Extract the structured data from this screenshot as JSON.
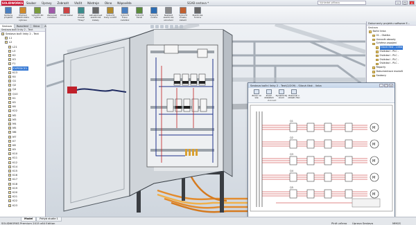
{
  "titlebar": {
    "logo": "SOLIDWORKS",
    "menu": [
      "Soubor",
      "Úpravy",
      "Zobrazit",
      "Vložit",
      "Nástroje",
      "Okno",
      "Nápověda"
    ],
    "document_title": "SGAB sestava *",
    "search_placeholder": "Vyhledat příkazy"
  },
  "ribbon": {
    "buttons": [
      {
        "label": "Správce projektů",
        "color": "#4a7fc0"
      },
      {
        "label": "Přehled elektrického výkresu",
        "color": "#d08a2b"
      },
      {
        "label": "Vytvořit 2D výkres",
        "color": "#7a9c3c"
      },
      {
        "label": "Zarovnat rozložení",
        "color": "#a05aa8"
      },
      {
        "label": "Přidat kabel",
        "color": "#c44"
      },
      {
        "label": "Přidat svazek \"Trasy\"",
        "color": "#3c8c8c"
      },
      {
        "label": "Aktualizovat elektrické kabely",
        "color": "#666"
      },
      {
        "label": "Vytvořit trasy vodičů",
        "color": "#b28a2c"
      },
      {
        "label": "Vytvořit trasu ovládání",
        "color": "#4a7fc0"
      },
      {
        "label": "Vytvořit kanál",
        "color": "#5b8a3c"
      },
      {
        "label": "Vytvořit vodiče",
        "color": "#2c6cb2"
      },
      {
        "label": "Nastavit elektrické ukončení",
        "color": "#888"
      },
      {
        "label": "Vytvořit kresbu kabelů",
        "color": "#c06030"
      },
      {
        "label": "Elektrické funkce",
        "color": "#666"
      }
    ]
  },
  "command_tabs": [
    "Sestava",
    "Rozvržení",
    "Skica",
    "Analýza",
    "Doplňkové moduly SOLIDWORKS",
    "SOLIDWORKS Electrical 3D"
  ],
  "left_panel": {
    "header": "Sestava bočí linky 2 - Text",
    "rows": [
      {
        "label": "Sestava bočí linky 2 - Text",
        "indent": 0
      },
      {
        "label": "L1",
        "indent": 1
      },
      {
        "label": "L2",
        "indent": 1
      },
      {
        "label": "L21",
        "indent": 2
      },
      {
        "label": "L3",
        "indent": 2
      },
      {
        "label": "K2",
        "indent": 2
      },
      {
        "label": "K3",
        "indent": 2
      },
      {
        "label": "F1",
        "indent": 2
      },
      {
        "label": "EXPEDICE1",
        "indent": 2,
        "selected": true
      },
      {
        "label": "K13",
        "indent": 2
      },
      {
        "label": "K4",
        "indent": 2
      },
      {
        "label": "Q1",
        "indent": 2
      },
      {
        "label": "Q2",
        "indent": 2
      },
      {
        "label": "Q4",
        "indent": 2
      },
      {
        "label": "Q10",
        "indent": 2
      },
      {
        "label": "K1",
        "indent": 2
      },
      {
        "label": "K5",
        "indent": 2
      },
      {
        "label": "K6",
        "indent": 2
      },
      {
        "label": "K22",
        "indent": 2
      },
      {
        "label": "M2",
        "indent": 2
      },
      {
        "label": "M3",
        "indent": 2
      },
      {
        "label": "M4",
        "indent": 2
      },
      {
        "label": "M5",
        "indent": 2
      },
      {
        "label": "M6",
        "indent": 2
      },
      {
        "label": "M7",
        "indent": 2
      },
      {
        "label": "K7",
        "indent": 2
      },
      {
        "label": "K8",
        "indent": 2
      },
      {
        "label": "K9",
        "indent": 2
      },
      {
        "label": "K10",
        "indent": 2
      },
      {
        "label": "K11",
        "indent": 2
      },
      {
        "label": "K12",
        "indent": 2
      },
      {
        "label": "K14",
        "indent": 2
      },
      {
        "label": "K15",
        "indent": 2
      },
      {
        "label": "K16",
        "indent": 2
      },
      {
        "label": "K17",
        "indent": 2
      },
      {
        "label": "K18",
        "indent": 2
      },
      {
        "label": "K19",
        "indent": 2
      },
      {
        "label": "K20",
        "indent": 2
      },
      {
        "label": "K21",
        "indent": 2
      },
      {
        "label": "K22",
        "indent": 2
      },
      {
        "label": "K23",
        "indent": 2
      }
    ]
  },
  "right_panel": {
    "header": "Dokumenty projektu software E...",
    "subheader": "Sestava",
    "rows": [
      {
        "label": "Boční linka",
        "indent": 0
      },
      {
        "label": "01 - Obálka",
        "indent": 1
      },
      {
        "label": "Uvnovik obvody",
        "indent": 1
      },
      {
        "label": "Schéma zapojení",
        "indent": 1
      },
      {
        "label": "Silová část - Linka",
        "indent": 2,
        "selected": true
      },
      {
        "label": "Ovládací - PLC -",
        "indent": 2
      },
      {
        "label": "Ovládací - PLC -",
        "indent": 2
      },
      {
        "label": "Ovládací - PLC -",
        "indent": 2
      },
      {
        "label": "Ovládací - PLC -",
        "indent": 2
      },
      {
        "label": "Reporty",
        "indent": 1
      },
      {
        "label": "Dokumentace modulů",
        "indent": 1
      },
      {
        "label": "Soubory",
        "indent": 1
      }
    ]
  },
  "schematic_window": {
    "title": "Sestava boční linky 2 - Text(2/209) - Silová část - linka",
    "buttons": [
      {
        "label": "Zoom na vše"
      },
      {
        "label": "Zoom oblastem"
      },
      {
        "label": "Dynamický zoom"
      },
      {
        "label": "Posunutí v oblasti čtec"
      }
    ],
    "group_label": "Zobrazit",
    "motor_labels": [
      "M",
      "M",
      "M",
      "M",
      "M"
    ],
    "tag_labels": [
      "Q1",
      "Q2",
      "Q3",
      "Q4",
      "Q5"
    ]
  },
  "status_bar": {
    "tabs": [
      "Model",
      "Pohyb studie 1"
    ],
    "text": "SOLIDWORKS Premium 2015 x64 Edition",
    "mid": "Plně určeno",
    "right": "Úprava Sestava",
    "units": "MMGS"
  }
}
